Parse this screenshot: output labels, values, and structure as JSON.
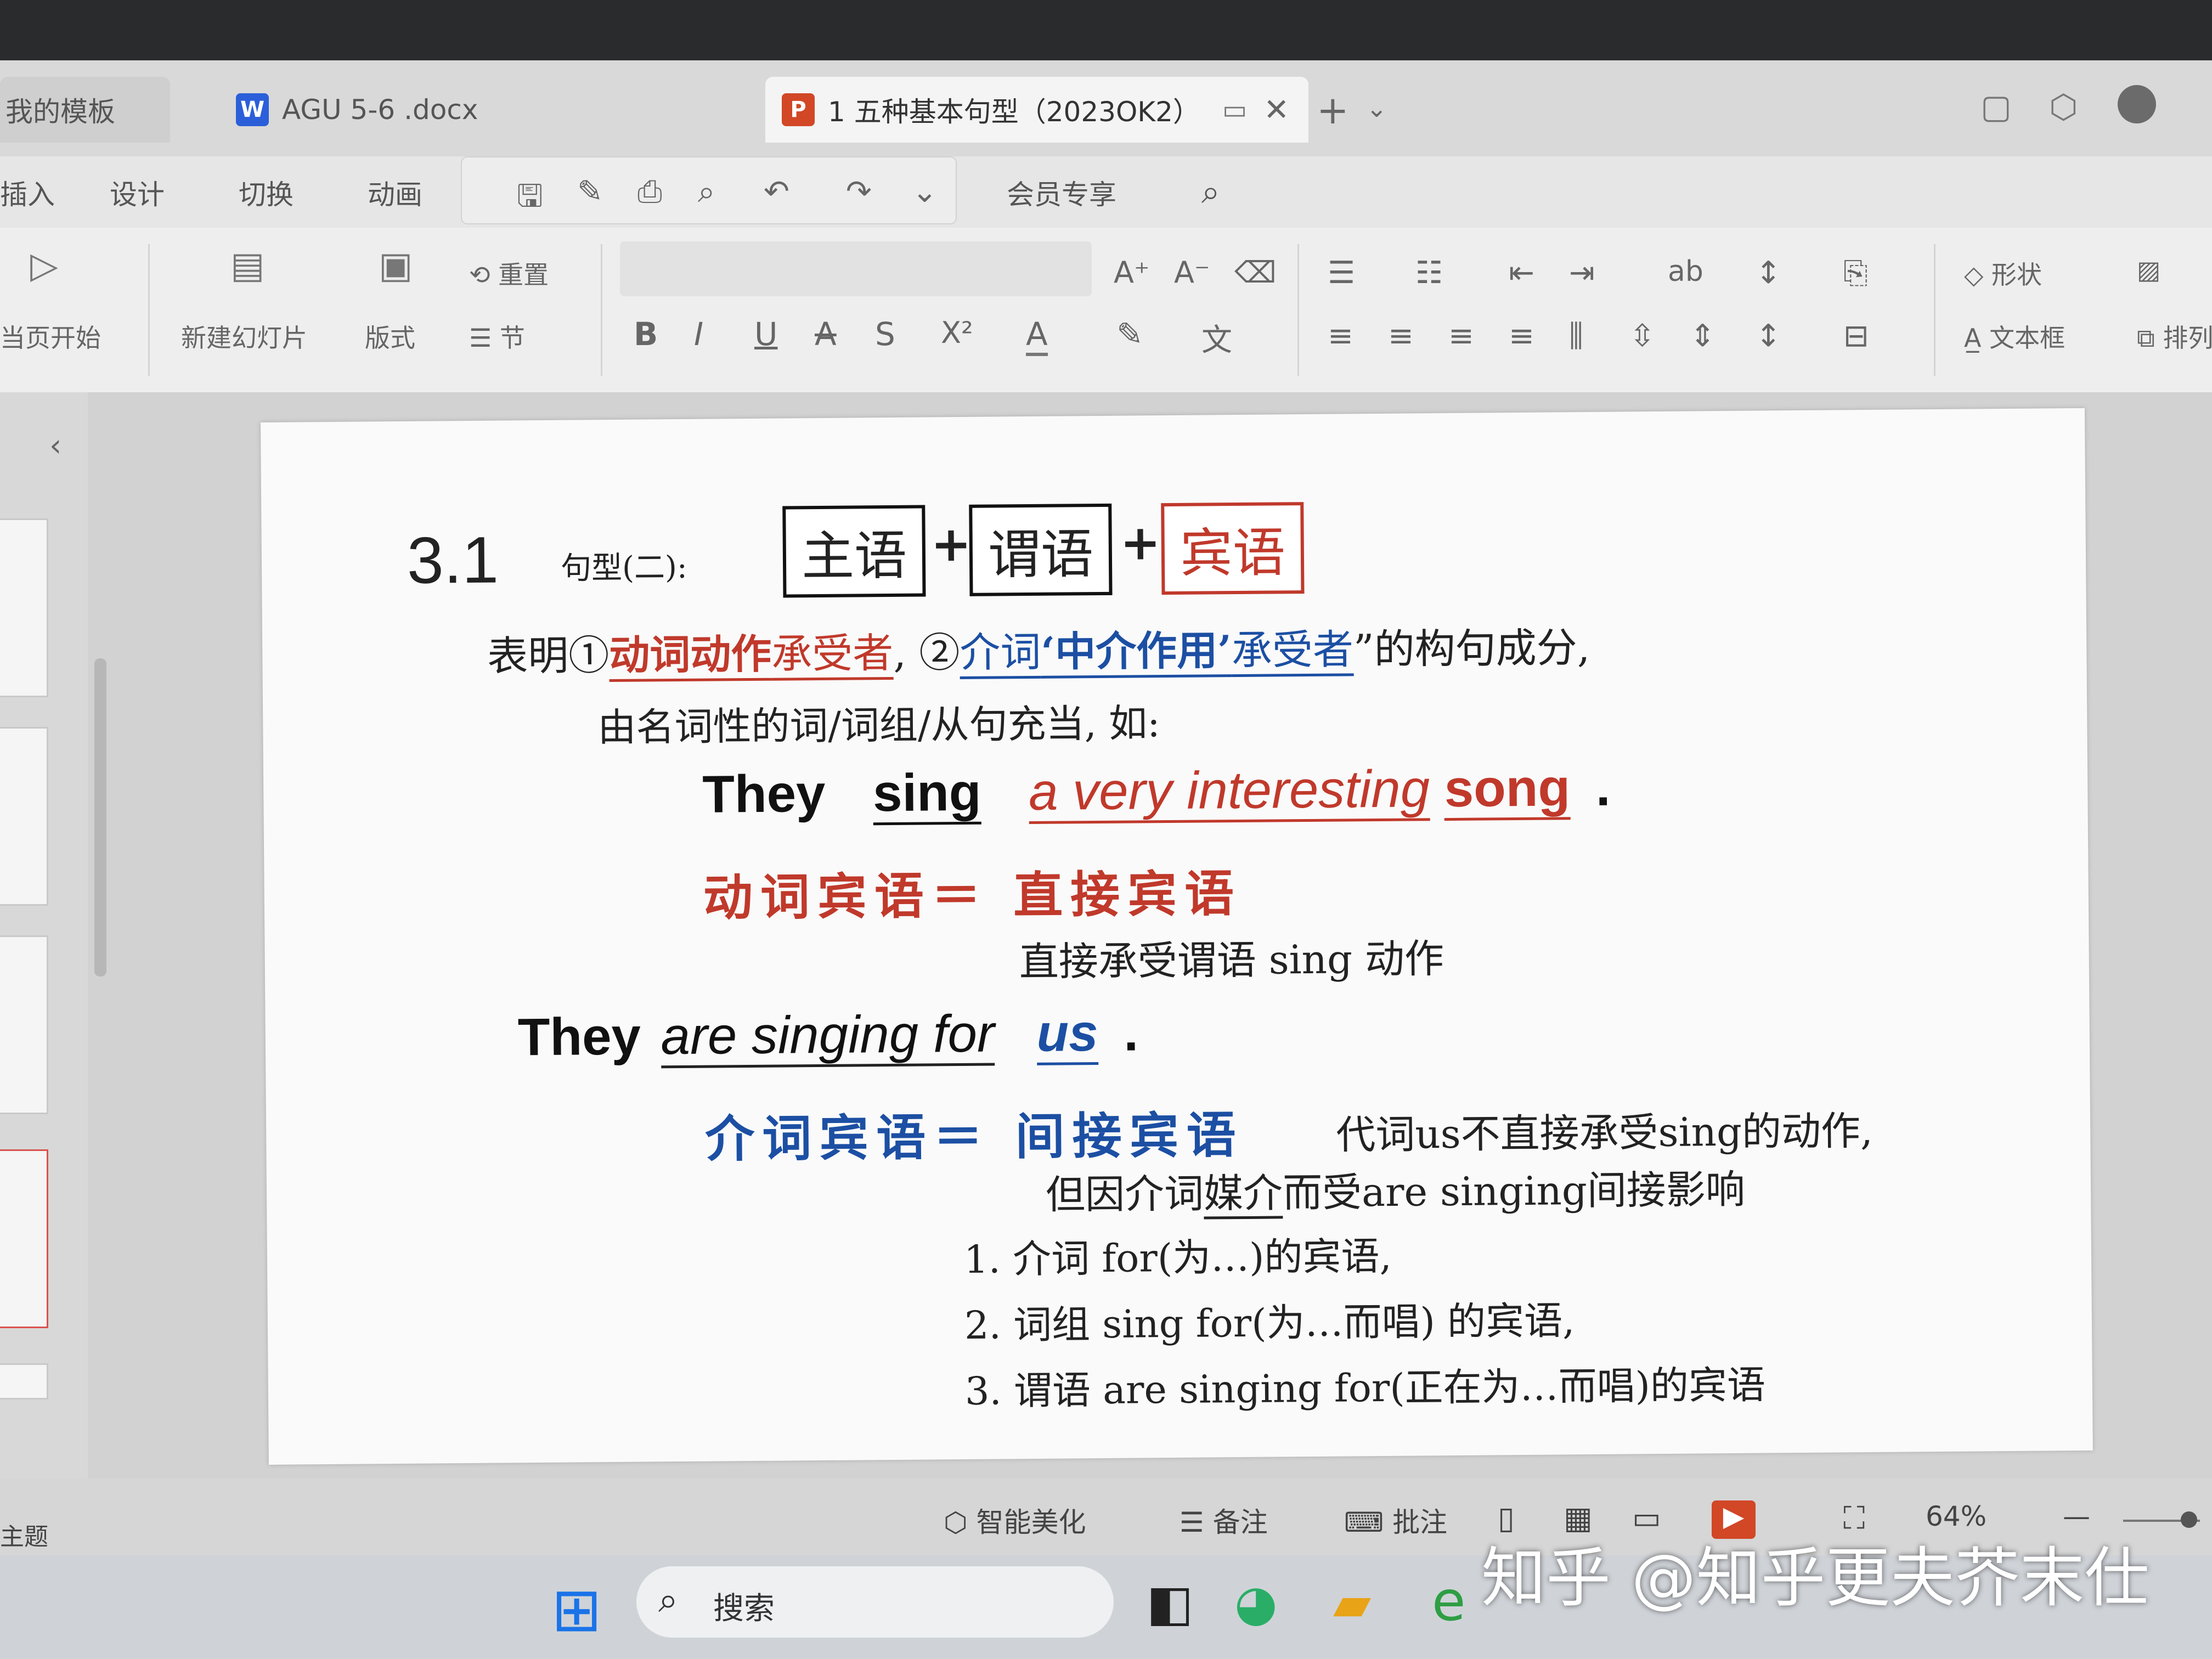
{
  "tabs": [
    {
      "label": "我的模板"
    },
    {
      "badge": "W",
      "label": "AGU 5-6 .docx"
    },
    {
      "badge": "P",
      "label": "1 五种基本句型（2023OK2）"
    }
  ],
  "menu": [
    "插入",
    "设计",
    "切换",
    "动画",
    "会员专享"
  ],
  "ribbon": {
    "play_label": "当页开始",
    "new_slide": "新建幻灯片",
    "layout": "版式",
    "reset": "重置",
    "section": "节",
    "shape": "形状",
    "textbox": "文本框",
    "arrange": "排列",
    "fmt_buttons": [
      "B",
      "I",
      "U",
      "A",
      "S",
      "X²",
      "A"
    ]
  },
  "slide": {
    "number": "3.1",
    "pattern_label": "句型(二):",
    "box_subject": "主语",
    "box_predicate": "谓语",
    "box_object": "宾语",
    "plus": "+",
    "line1_a": "表明①",
    "line1_b": "动词动作",
    "line1_c": "承受者",
    "line1_d": ", ②",
    "line1_e": "介词",
    "line1_f": "‘中介作用’",
    "line1_g": "承受者",
    "line1_h": "”的构句成分,",
    "line2": "由名词性的词/词组/从句充当, 如:",
    "s1_they": "They",
    "s1_sing": "sing",
    "s1_obj": "a very interesting",
    "s1_song": "song",
    "s1_dot": ".",
    "verb_obj_label": "动词宾语＝ 直接宾语",
    "verb_obj_note": "直接承受谓语 sing 动作",
    "s2_they": "They",
    "s2_pred": "are singing for",
    "s2_us": "us",
    "s2_dot": ".",
    "prep_obj_label": "介词宾语＝ 间接宾语",
    "prep_obj_note1": "代词us不直接承受sing的动作,",
    "prep_obj_note2a": "但因介词",
    "prep_obj_note2b": "媒介",
    "prep_obj_note2c": "而受are singing间接影响",
    "list": [
      "1. 介词 for(为…)的宾语,",
      "2. 词组 sing for(为…而唱) 的宾语,",
      "3. 谓语 are singing for(正在为…而唱)的宾语"
    ]
  },
  "status": {
    "beautify": "智能美化",
    "notes": "备注",
    "comment": "批注",
    "zoom": "64%",
    "theme": "主题"
  },
  "taskbar": {
    "search_placeholder": "搜索"
  },
  "watermark": "知乎 @知乎更夫芥末仕",
  "colors": {
    "red": "#c0392b",
    "blue": "#1c4fa3",
    "text": "#222222"
  }
}
